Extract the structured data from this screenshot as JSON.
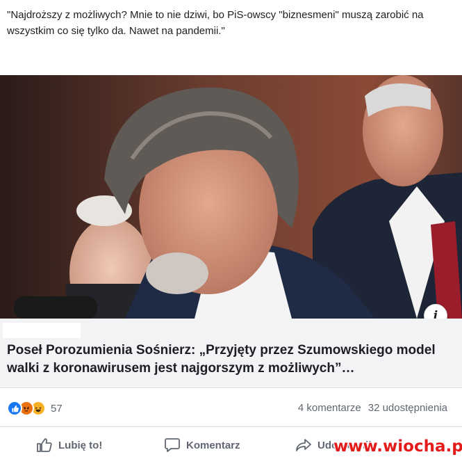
{
  "post": {
    "text": "\"Najdroższy z możliwych? Mnie to nie dziwi, bo PiS-owscy \"biznesmeni\" muszą zarobić na wszystkim co się tylko da. Nawet na pandemii.\""
  },
  "link_preview": {
    "title": "Poseł Porozumienia Sośnierz: „Przyjęty przez Szumowskiego model walki z koronawirusem jest najgorszym z możliwych”…",
    "info_icon_glyph": "i"
  },
  "reactions": {
    "count": "57",
    "icons": [
      "like-icon",
      "angry-icon",
      "haha-icon"
    ]
  },
  "stats": {
    "comments": "4 komentarze",
    "shares": "32 udostępnienia"
  },
  "actions": {
    "like": "Lubię to!",
    "comment": "Komentarz",
    "share": "Udostępnij"
  },
  "watermark": "www.wiocha.pl",
  "colors": {
    "like_blue": "#1877f2",
    "angry_orange": "#e9710f",
    "haha_yellow": "#f7b125",
    "secondary_text": "#606770",
    "watermark_red": "#e41b1b"
  }
}
